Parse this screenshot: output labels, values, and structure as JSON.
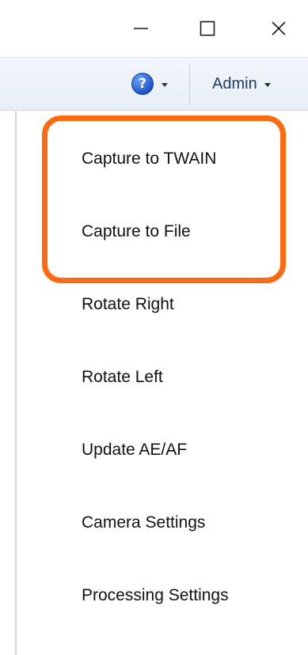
{
  "window_controls": {
    "minimize_glyph": "—",
    "maximize_glyph": "☐",
    "close_glyph": "✕"
  },
  "toolbar": {
    "help_icon_glyph": "?",
    "admin_label": "Admin"
  },
  "menu": {
    "items": [
      {
        "label": "Capture to TWAIN"
      },
      {
        "label": "Capture to File"
      },
      {
        "label": "Rotate Right"
      },
      {
        "label": "Rotate Left"
      },
      {
        "label": "Update AE/AF"
      },
      {
        "label": "Camera Settings"
      },
      {
        "label": "Processing Settings"
      }
    ]
  },
  "highlight": {
    "color": "#ff6a10"
  },
  "colors": {
    "toolbar_bg": "#eaf0f8",
    "admin_text": "#1e3c64",
    "help_icon": "#1d55c9"
  }
}
